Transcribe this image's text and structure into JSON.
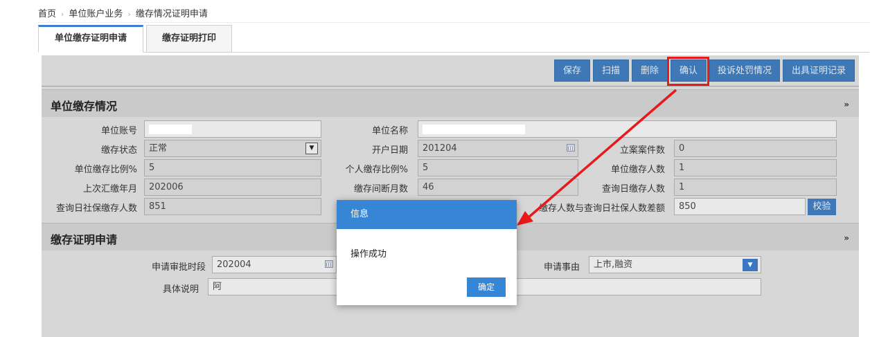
{
  "breadcrumb": {
    "home": "首页",
    "level2": "单位账户业务",
    "level3": "缴存情况证明申请"
  },
  "tabs": [
    "单位缴存证明申请",
    "缴存证明打印"
  ],
  "toolbar": {
    "save": "保存",
    "scan": "扫描",
    "delete": "删除",
    "confirm": "确认",
    "complaint": "投诉处罚情况",
    "cert_record": "出具证明记录"
  },
  "section1": {
    "title": "单位缴存情况",
    "fields": {
      "unit_account": {
        "label": "单位账号",
        "value": ""
      },
      "unit_name": {
        "label": "单位名称",
        "value": ""
      },
      "deposit_status": {
        "label": "缴存状态",
        "value": "正常"
      },
      "open_date": {
        "label": "开户日期",
        "value": "201204"
      },
      "case_count": {
        "label": "立案案件数",
        "value": "0"
      },
      "unit_ratio": {
        "label": "单位缴存比例%",
        "value": "5"
      },
      "personal_ratio": {
        "label": "个人缴存比例%",
        "value": "5"
      },
      "unit_depositors": {
        "label": "单位缴存人数",
        "value": "1"
      },
      "last_month": {
        "label": "上次汇缴年月",
        "value": "202006"
      },
      "interrupt_months": {
        "label": "缴存间断月数",
        "value": "46"
      },
      "query_depositors": {
        "label": "查询日缴存人数",
        "value": "1"
      },
      "social_count": {
        "label": "查询日社保缴存人数",
        "value": "851"
      },
      "diff": {
        "label": "缴存人数与查询日社保人数差额",
        "value": "850"
      }
    },
    "check_button": "校验"
  },
  "section2": {
    "title": "缴存证明申请",
    "period": {
      "label": "申请审批时段",
      "value": "202004"
    },
    "reason": {
      "label": "申请事由",
      "value": "上市,融资"
    },
    "description": {
      "label": "具体说明",
      "value": "阿"
    }
  },
  "dialog": {
    "title": "信息",
    "message": "操作成功",
    "ok": "确定"
  },
  "colors": {
    "primary_button": "#3f78b6",
    "dialog_header": "#3786d6",
    "annotation_red": "#e8191b"
  }
}
